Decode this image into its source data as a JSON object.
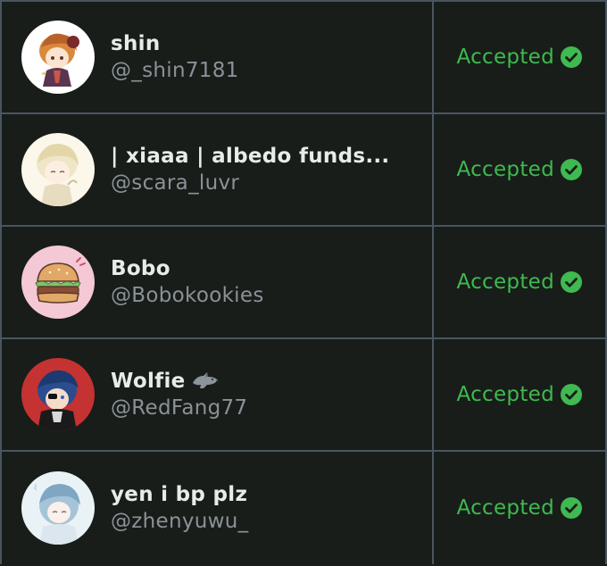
{
  "colors": {
    "background": "#181d19",
    "grid_line": "#4a5560",
    "name_text": "#e8ebe9",
    "handle_text": "#8a9298",
    "accepted_green": "#3fb950"
  },
  "rows": [
    {
      "display_name": "shin",
      "handle": "@_shin7181",
      "status": "Accepted",
      "avatar_icon": "avatar-shin"
    },
    {
      "display_name": "| xiaaa | albedo funds...",
      "handle": "@scara_luvr",
      "status": "Accepted",
      "avatar_icon": "avatar-xiaaa"
    },
    {
      "display_name": "Bobo",
      "handle": "@Bobokookies",
      "status": "Accepted",
      "avatar_icon": "avatar-burger"
    },
    {
      "display_name": "Wolfie",
      "handle": "@RedFang77",
      "status": "Accepted",
      "avatar_icon": "avatar-wolfie",
      "name_emoji": "wolf-icon"
    },
    {
      "display_name": "yen i bp plz",
      "handle": "@zhenyuwu_",
      "status": "Accepted",
      "avatar_icon": "avatar-yen"
    }
  ]
}
